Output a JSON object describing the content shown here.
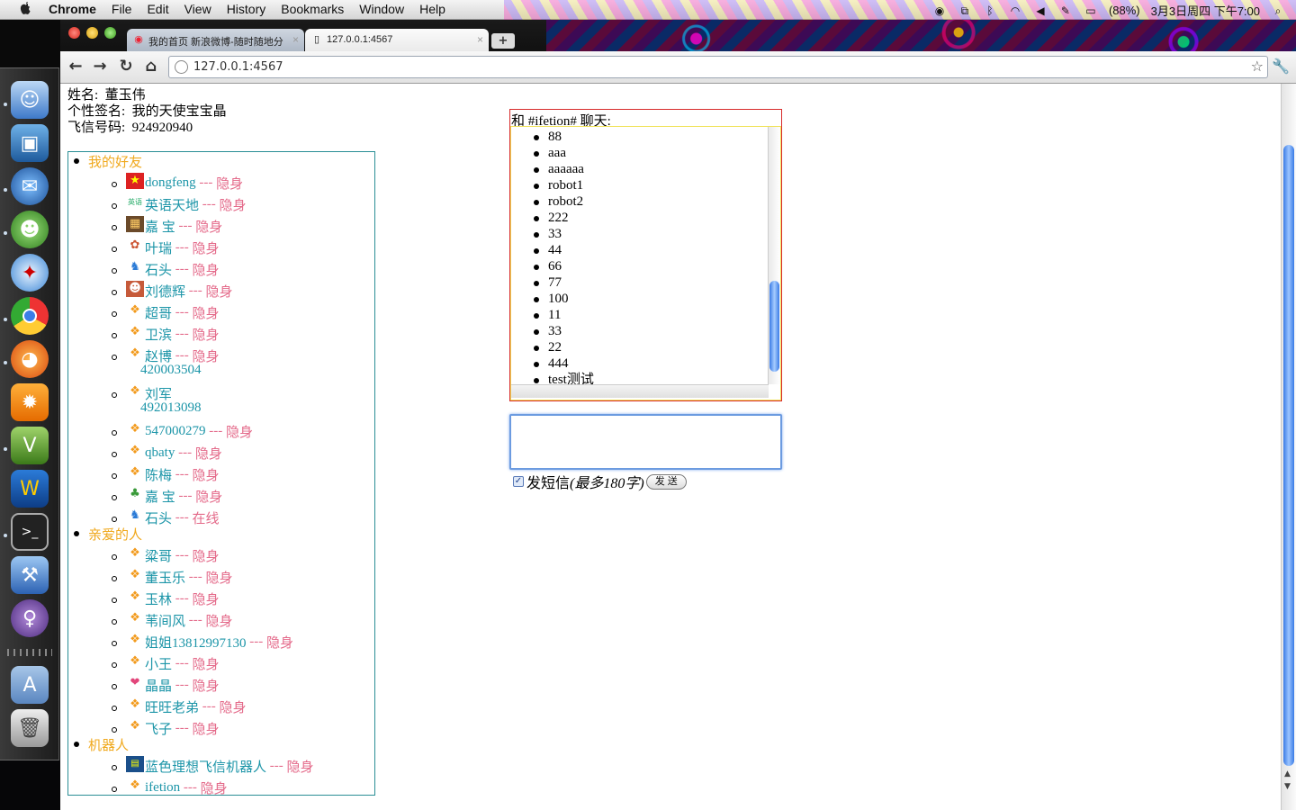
{
  "menubar": {
    "app": "Chrome",
    "menus": [
      "File",
      "Edit",
      "View",
      "History",
      "Bookmarks",
      "Window",
      "Help"
    ],
    "battery": "(88%)",
    "datetime": "3月3日周四 下午7:00"
  },
  "tabs": [
    {
      "title": "我的首页 新浪微博-随时随地分"
    },
    {
      "title": "127.0.0.1:4567"
    }
  ],
  "address": {
    "url": "127.0.0.1:4567"
  },
  "profile": {
    "name_label": "姓名:",
    "name": "董玉伟",
    "sign_label": "个性签名:",
    "sign": "我的天使宝宝晶",
    "fetion_label": "飞信号码:",
    "fetion": "924920940"
  },
  "groups": [
    {
      "name": "我的好友"
    },
    {
      "name": "亲爱的人"
    },
    {
      "name": "机器人"
    }
  ],
  "friends": [
    {
      "name": "dongfeng",
      "sep": "---",
      "status": "隐身"
    },
    {
      "name": "英语天地",
      "sep": "---",
      "status": "隐身"
    },
    {
      "name": "嘉 宝",
      "sep": "---",
      "status": "隐身"
    },
    {
      "name": "叶瑞",
      "sep": "---",
      "status": "隐身"
    },
    {
      "name": "石头",
      "sep": "---",
      "status": "隐身"
    },
    {
      "name": "刘德辉",
      "sep": "---",
      "status": "隐身"
    },
    {
      "name": "超哥",
      "sep": "---",
      "status": "隐身"
    },
    {
      "name": "卫滨",
      "sep": "---",
      "status": "隐身"
    },
    {
      "name": "赵博",
      "sep": "---",
      "status": "隐身"
    },
    {
      "name": "420003504"
    },
    {
      "name": " 刘军"
    },
    {
      "name": "492013098"
    },
    {
      "name": "547000279",
      "sep": "---",
      "status": "隐身"
    },
    {
      "name": "qbaty",
      "sep": "---",
      "status": "隐身"
    },
    {
      "name": "陈梅",
      "sep": "---",
      "status": "隐身"
    },
    {
      "name": "嘉 宝",
      "sep": "---",
      "status": "隐身"
    },
    {
      "name": "石头",
      "sep": "---",
      "status": "在线"
    },
    {
      "name": "粱哥",
      "sep": "---",
      "status": "隐身"
    },
    {
      "name": "董玉乐",
      "sep": "---",
      "status": "隐身"
    },
    {
      "name": "玉林",
      "sep": "---",
      "status": "隐身"
    },
    {
      "name": "苇间风",
      "sep": "---",
      "status": "隐身"
    },
    {
      "name": "姐姐13812997130",
      "sep": "---",
      "status": "隐身"
    },
    {
      "name": "小王",
      "sep": "---",
      "status": "隐身"
    },
    {
      "name": "晶晶",
      "sep": "---",
      "status": "隐身"
    },
    {
      "name": "旺旺老弟",
      "sep": "---",
      "status": "隐身"
    },
    {
      "name": "飞子",
      "sep": "---",
      "status": "隐身"
    },
    {
      "name": "蓝色理想飞信机器人",
      "sep": "---",
      "status": "隐身"
    },
    {
      "name": "ifetion",
      "sep": "---",
      "status": "隐身"
    }
  ],
  "chat": {
    "title": "和 #ifetion# 聊天:",
    "messages": [
      "88",
      "aaa",
      "aaaaaa",
      "robot1",
      "robot2",
      "222",
      "33",
      "44",
      "66",
      "77",
      "100",
      "11",
      "33",
      "22",
      "444",
      "test测试"
    ],
    "sms_label": "发短信",
    "sms_hint": "(最多180字)",
    "send_label": "发 送"
  },
  "colors": {
    "group": "#f0a91e",
    "friend_name": "#1c95a8",
    "status": "#e46a8a",
    "contacts_border": "#2a8e95",
    "chat_border": "#d82b2b"
  }
}
